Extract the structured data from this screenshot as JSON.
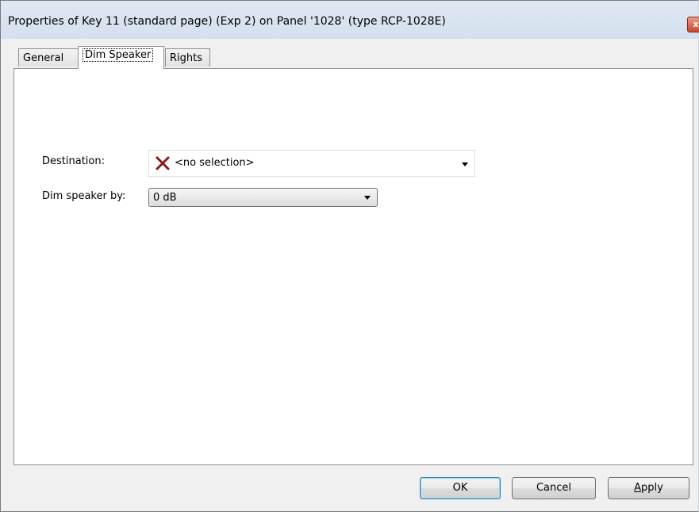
{
  "window": {
    "title": "Properties of Key 11 (standard page) (Exp 2) on Panel '1028' (type RCP-1028E)",
    "close_glyph": "x"
  },
  "tabs": [
    {
      "label": "General",
      "active": false
    },
    {
      "label": "Dim Speaker",
      "active": true
    },
    {
      "label": "Rights",
      "active": false
    }
  ],
  "form": {
    "destination_label": "Destination:",
    "destination_value": "<no selection>",
    "destination_icon": "red-x-icon",
    "dim_label": "Dim speaker by:",
    "dim_value": "0 dB"
  },
  "buttons": {
    "ok": "OK",
    "cancel": "Cancel",
    "apply_accel": "A",
    "apply_rest": "pply"
  },
  "colors": {
    "x_icon": "#8b1a1a",
    "default_button_border": "#3c7fb1"
  }
}
